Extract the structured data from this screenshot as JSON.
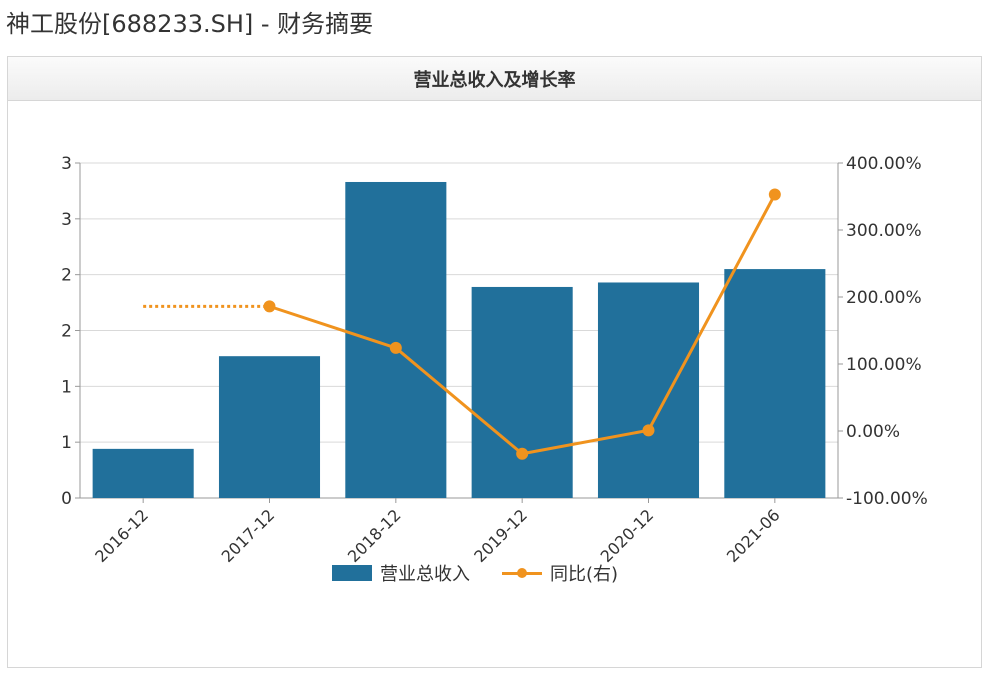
{
  "page": {
    "title": "神工股份[688233.SH] - 财务摘要"
  },
  "panel": {
    "title": "营业总收入及增长率"
  },
  "legend": {
    "bar_label": "营业总收入",
    "line_label": "同比(右)"
  },
  "colors": {
    "bar": "#21709b",
    "line": "#f0931e",
    "grid": "#d9d9d9",
    "axis": "#999999",
    "text": "#333333"
  },
  "chart_data": {
    "type": "bar",
    "categories": [
      "2016-12",
      "2017-12",
      "2018-12",
      "2019-12",
      "2020-12",
      "2021-06"
    ],
    "left_axis": {
      "ticks": [
        0,
        0.5,
        1,
        1.5,
        2,
        2.5,
        3
      ],
      "tick_labels": [
        "0",
        "1",
        "1",
        "2",
        "2",
        "3",
        "3"
      ],
      "ylim": [
        0,
        3
      ]
    },
    "right_axis": {
      "ticks": [
        -100,
        0,
        100,
        200,
        300,
        400
      ],
      "tick_labels": [
        "-100.00%",
        "0.00%",
        "100.00%",
        "200.00%",
        "300.00%",
        "400.00%"
      ],
      "ylim": [
        -100,
        400
      ]
    },
    "series": [
      {
        "name": "营业总收入",
        "type": "bar",
        "axis": "left",
        "values": [
          0.44,
          1.27,
          2.83,
          1.89,
          1.93,
          2.05
        ]
      },
      {
        "name": "同比(右)",
        "type": "line",
        "axis": "right",
        "values": [
          null,
          186,
          124,
          -34,
          1,
          353
        ],
        "dotted_lead": {
          "from": "2016-12",
          "value": 186
        }
      }
    ],
    "grid": true,
    "legend_position": "bottom"
  }
}
